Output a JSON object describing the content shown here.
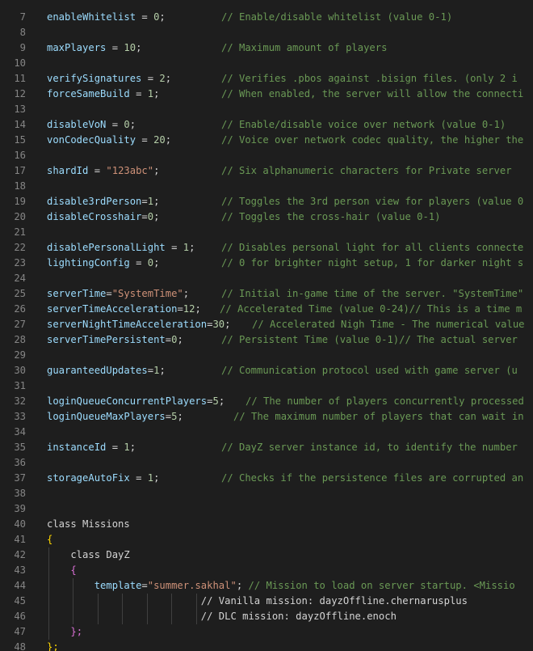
{
  "colors": {
    "background": "#1e1e1e",
    "line_number": "#858585",
    "identifier": "#9cdcfe",
    "number": "#b5cea8",
    "string": "#ce9178",
    "comment": "#6a9955",
    "operator": "#d4d4d4",
    "bracket_level1": "#ffd700",
    "bracket_level2": "#da70d6"
  },
  "lines": [
    {
      "n": "7",
      "tokens": [
        {
          "t": "enableWhitelist",
          "c": "ident"
        },
        {
          "t": " = ",
          "c": "op"
        },
        {
          "t": "0",
          "c": "num"
        },
        {
          "t": ";",
          "c": "op"
        }
      ],
      "comment": "// Enable/disable whitelist (value 0-1)"
    },
    {
      "n": "8",
      "tokens": [],
      "comment": ""
    },
    {
      "n": "9",
      "tokens": [
        {
          "t": "maxPlayers",
          "c": "ident"
        },
        {
          "t": " = ",
          "c": "op"
        },
        {
          "t": "10",
          "c": "num"
        },
        {
          "t": ";",
          "c": "op"
        }
      ],
      "comment": "// Maximum amount of players"
    },
    {
      "n": "10",
      "tokens": [],
      "comment": ""
    },
    {
      "n": "11",
      "tokens": [
        {
          "t": "verifySignatures",
          "c": "ident"
        },
        {
          "t": " = ",
          "c": "op"
        },
        {
          "t": "2",
          "c": "num"
        },
        {
          "t": ";",
          "c": "op"
        }
      ],
      "comment": "// Verifies .pbos against .bisign files. (only 2 i"
    },
    {
      "n": "12",
      "tokens": [
        {
          "t": "forceSameBuild",
          "c": "ident"
        },
        {
          "t": " = ",
          "c": "op"
        },
        {
          "t": "1",
          "c": "num"
        },
        {
          "t": ";",
          "c": "op"
        }
      ],
      "comment": "// When enabled, the server will allow the connecti"
    },
    {
      "n": "13",
      "tokens": [],
      "comment": ""
    },
    {
      "n": "14",
      "tokens": [
        {
          "t": "disableVoN",
          "c": "ident"
        },
        {
          "t": " = ",
          "c": "op"
        },
        {
          "t": "0",
          "c": "num"
        },
        {
          "t": ";",
          "c": "op"
        }
      ],
      "comment": "// Enable/disable voice over network (value 0-1)"
    },
    {
      "n": "15",
      "tokens": [
        {
          "t": "vonCodecQuality",
          "c": "ident"
        },
        {
          "t": " = ",
          "c": "op"
        },
        {
          "t": "20",
          "c": "num"
        },
        {
          "t": ";",
          "c": "op"
        }
      ],
      "comment": "// Voice over network codec quality, the higher the"
    },
    {
      "n": "16",
      "tokens": [],
      "comment": ""
    },
    {
      "n": "17",
      "tokens": [
        {
          "t": "shardId",
          "c": "ident"
        },
        {
          "t": " = ",
          "c": "op"
        },
        {
          "t": "\"123abc\"",
          "c": "str"
        },
        {
          "t": ";",
          "c": "op"
        }
      ],
      "comment": "// Six alphanumeric characters for Private server"
    },
    {
      "n": "18",
      "tokens": [],
      "comment": ""
    },
    {
      "n": "19",
      "tokens": [
        {
          "t": "disable3rdPerson",
          "c": "ident"
        },
        {
          "t": "=",
          "c": "op"
        },
        {
          "t": "1",
          "c": "num"
        },
        {
          "t": ";",
          "c": "op"
        }
      ],
      "comment": "// Toggles the 3rd person view for players (value 0"
    },
    {
      "n": "20",
      "tokens": [
        {
          "t": "disableCrosshair",
          "c": "ident"
        },
        {
          "t": "=",
          "c": "op"
        },
        {
          "t": "0",
          "c": "num"
        },
        {
          "t": ";",
          "c": "op"
        }
      ],
      "comment": "// Toggles the cross-hair (value 0-1)"
    },
    {
      "n": "21",
      "tokens": [],
      "comment": ""
    },
    {
      "n": "22",
      "tokens": [
        {
          "t": "disablePersonalLight",
          "c": "ident"
        },
        {
          "t": " = ",
          "c": "op"
        },
        {
          "t": "1",
          "c": "num"
        },
        {
          "t": ";",
          "c": "op"
        }
      ],
      "comment": "// Disables personal light for all clients connecte"
    },
    {
      "n": "23",
      "tokens": [
        {
          "t": "lightingConfig",
          "c": "ident"
        },
        {
          "t": " = ",
          "c": "op"
        },
        {
          "t": "0",
          "c": "num"
        },
        {
          "t": ";",
          "c": "op"
        }
      ],
      "comment": "// 0 for brighter night setup, 1 for darker night s"
    },
    {
      "n": "24",
      "tokens": [],
      "comment": ""
    },
    {
      "n": "25",
      "tokens": [
        {
          "t": "serverTime",
          "c": "ident"
        },
        {
          "t": "=",
          "c": "op"
        },
        {
          "t": "\"SystemTime\"",
          "c": "str"
        },
        {
          "t": ";",
          "c": "op"
        }
      ],
      "comment": "// Initial in-game time of the server. \"SystemTime\""
    },
    {
      "n": "26",
      "tokens": [
        {
          "t": "serverTimeAcceleration",
          "c": "ident"
        },
        {
          "t": "=",
          "c": "op"
        },
        {
          "t": "12",
          "c": "num"
        },
        {
          "t": ";",
          "c": "op"
        }
      ],
      "comment": "// Accelerated Time (value 0-24)// This is a time m"
    },
    {
      "n": "27",
      "tokens": [
        {
          "t": "serverNightTimeAcceleration",
          "c": "ident"
        },
        {
          "t": "=",
          "c": "op"
        },
        {
          "t": "30",
          "c": "num"
        },
        {
          "t": ";",
          "c": "op"
        }
      ],
      "comment": "// Accelerated Nigh Time - The numerical value"
    },
    {
      "n": "28",
      "tokens": [
        {
          "t": "serverTimePersistent",
          "c": "ident"
        },
        {
          "t": "=",
          "c": "op"
        },
        {
          "t": "0",
          "c": "num"
        },
        {
          "t": ";",
          "c": "op"
        }
      ],
      "comment": "// Persistent Time (value 0-1)// The actual server"
    },
    {
      "n": "29",
      "tokens": [],
      "comment": ""
    },
    {
      "n": "30",
      "tokens": [
        {
          "t": "guaranteedUpdates",
          "c": "ident"
        },
        {
          "t": "=",
          "c": "op"
        },
        {
          "t": "1",
          "c": "num"
        },
        {
          "t": ";",
          "c": "op"
        }
      ],
      "comment": "// Communication protocol used with game server (u"
    },
    {
      "n": "31",
      "tokens": [],
      "comment": ""
    },
    {
      "n": "32",
      "tokens": [
        {
          "t": "loginQueueConcurrentPlayers",
          "c": "ident"
        },
        {
          "t": "=",
          "c": "op"
        },
        {
          "t": "5",
          "c": "num"
        },
        {
          "t": ";",
          "c": "op"
        }
      ],
      "comment": "// The number of players concurrently processed"
    },
    {
      "n": "33",
      "tokens": [
        {
          "t": "loginQueueMaxPlayers",
          "c": "ident"
        },
        {
          "t": "=",
          "c": "op"
        },
        {
          "t": "5",
          "c": "num"
        },
        {
          "t": ";",
          "c": "op"
        }
      ],
      "comment": "// The maximum number of players that can wait in"
    },
    {
      "n": "34",
      "tokens": [],
      "comment": ""
    },
    {
      "n": "35",
      "tokens": [
        {
          "t": "instanceId",
          "c": "ident"
        },
        {
          "t": " = ",
          "c": "op"
        },
        {
          "t": "1",
          "c": "num"
        },
        {
          "t": ";",
          "c": "op"
        }
      ],
      "comment": "// DayZ server instance id, to identify the number"
    },
    {
      "n": "36",
      "tokens": [],
      "comment": ""
    },
    {
      "n": "37",
      "tokens": [
        {
          "t": "storageAutoFix",
          "c": "ident"
        },
        {
          "t": " = ",
          "c": "op"
        },
        {
          "t": "1",
          "c": "num"
        },
        {
          "t": ";",
          "c": "op"
        }
      ],
      "comment": "// Checks if the persistence files are corrupted an"
    },
    {
      "n": "38",
      "tokens": [],
      "comment": ""
    },
    {
      "n": "39",
      "tokens": [],
      "comment": ""
    },
    {
      "n": "40",
      "tokens": [
        {
          "t": "class Missions",
          "c": "plain"
        }
      ],
      "comment": ""
    },
    {
      "n": "41",
      "tokens": [
        {
          "t": "{",
          "c": "b1"
        }
      ],
      "comment": ""
    },
    {
      "n": "42",
      "tokens": [
        {
          "t": "    class DayZ",
          "c": "plain"
        }
      ],
      "comment": ""
    },
    {
      "n": "43",
      "tokens": [
        {
          "t": "    ",
          "c": "plain"
        },
        {
          "t": "{",
          "c": "b2"
        }
      ],
      "comment": ""
    },
    {
      "n": "44",
      "tokens": [
        {
          "t": "        ",
          "c": "plain"
        },
        {
          "t": "template",
          "c": "ident"
        },
        {
          "t": "=",
          "c": "op"
        },
        {
          "t": "\"summer.sakhal\"",
          "c": "str"
        },
        {
          "t": "; ",
          "c": "op"
        },
        {
          "t": "// Mission to load on server startup. <Missio",
          "c": "com"
        }
      ],
      "comment": ""
    },
    {
      "n": "45",
      "tokens": [
        {
          "t": "                          // Vanilla mission: dayzOffline.chernarusplus",
          "c": "plain"
        }
      ],
      "comment": ""
    },
    {
      "n": "46",
      "tokens": [
        {
          "t": "                          // DLC mission: dayzOffline.enoch",
          "c": "plain"
        }
      ],
      "comment": ""
    },
    {
      "n": "47",
      "tokens": [
        {
          "t": "    ",
          "c": "plain"
        },
        {
          "t": "};",
          "c": "b2"
        }
      ],
      "comment": ""
    },
    {
      "n": "48",
      "tokens": [
        {
          "t": "};",
          "c": "b1"
        }
      ],
      "comment": ""
    }
  ]
}
